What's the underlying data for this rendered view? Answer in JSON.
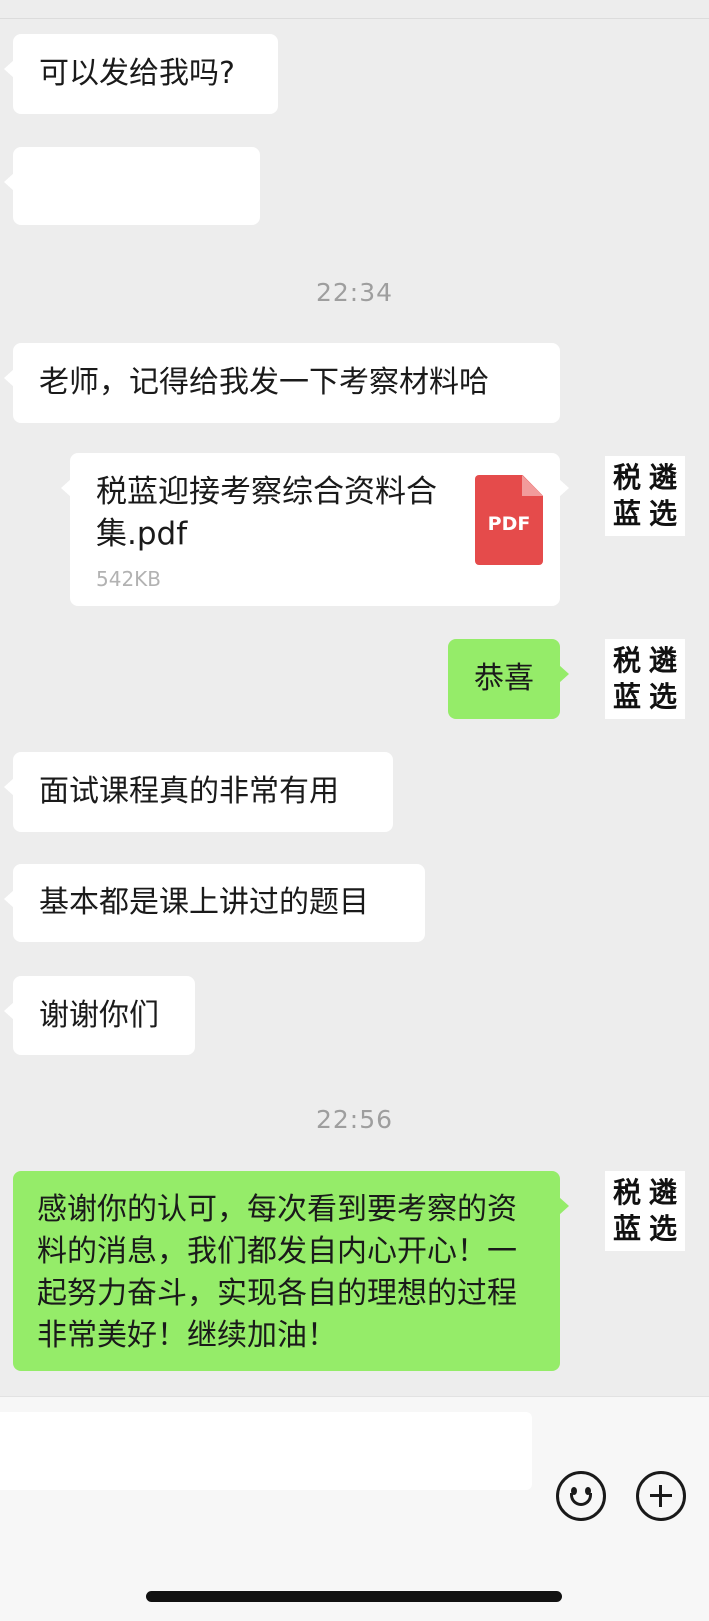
{
  "messages": {
    "m1": {
      "text": "可以发给我吗?"
    },
    "m2": {
      "text": ""
    },
    "t1": {
      "text": "22:34"
    },
    "m3": {
      "text": "老师，记得给我发一下考察材料哈"
    },
    "file": {
      "name": "税蓝迎接考察综合资料合集.pdf",
      "size": "542KB",
      "icon_label": "PDF"
    },
    "m4": {
      "text": "恭喜"
    },
    "m5": {
      "text": "面试课程真的非常有用"
    },
    "m6": {
      "text": "基本都是课上讲过的题目"
    },
    "m7": {
      "text": "谢谢你们"
    },
    "t2": {
      "text": "22:56"
    },
    "m8": {
      "text": "感谢你的认可，每次看到要考察的资料的消息，我们都发自内心开心！一起努力奋斗，实现各自的理想的过程非常美好！继续加油！"
    }
  },
  "avatar": {
    "chars": [
      "税",
      "遴",
      "蓝",
      "选"
    ]
  },
  "input_bar": {
    "emoji_icon": "smiley-icon",
    "plus_icon": "plus-icon"
  },
  "colors": {
    "background": "#ededed",
    "incoming": "#ffffff",
    "outgoing": "#95ec69",
    "pdf": "#e54b4b"
  }
}
